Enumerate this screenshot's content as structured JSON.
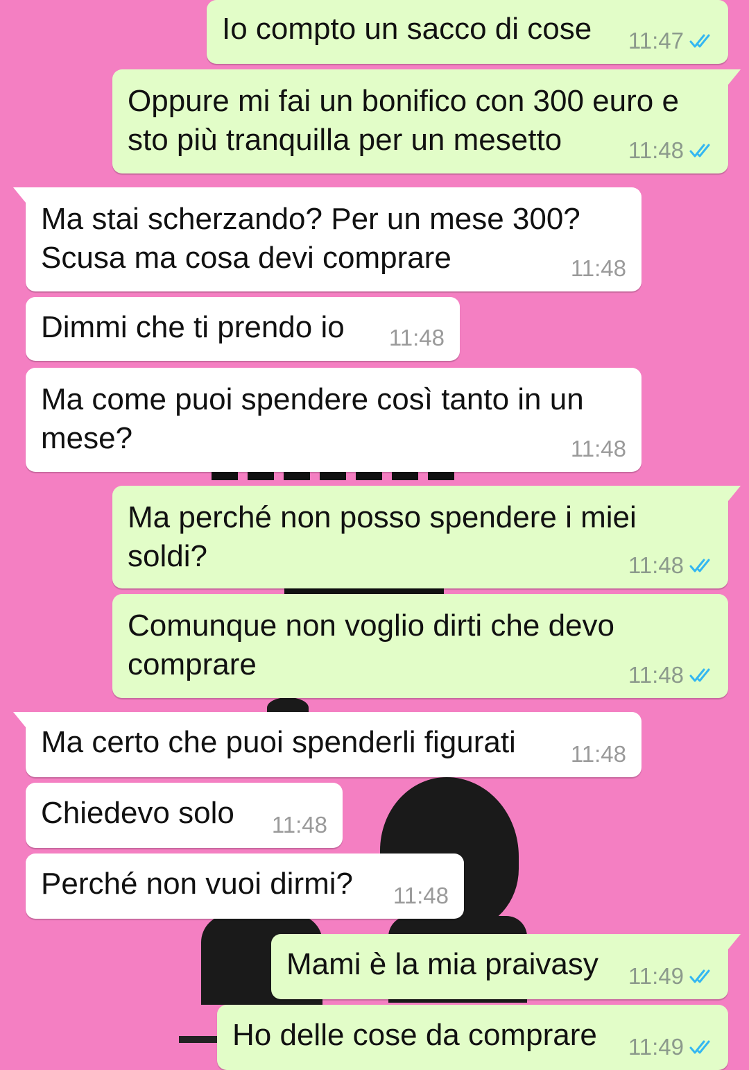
{
  "theme": {
    "wallpaper": "#f47fc2",
    "outgoing_bubble": "#e2fdc8",
    "incoming_bubble": "#ffffff",
    "read_ticks": "#34b7f1"
  },
  "messages": [
    {
      "direction": "out",
      "text": "Io compto un sacco di cose",
      "time": "11:47",
      "status_icon": "double-check-read-icon"
    },
    {
      "direction": "out",
      "text": "Oppure mi fai un bonifico con 300 euro e sto più tranquilla per un mesetto",
      "time": "11:48",
      "status_icon": "double-check-read-icon"
    },
    {
      "direction": "in",
      "text": "Ma stai scherzando? Per un mese 300? Scusa ma cosa devi comprare",
      "time": "11:48"
    },
    {
      "direction": "in",
      "text": "Dimmi che ti prendo io",
      "time": "11:48"
    },
    {
      "direction": "in",
      "text": "Ma come puoi spendere così tanto in un mese?",
      "time": "11:48"
    },
    {
      "direction": "out",
      "text": "Ma perché non posso spendere i miei soldi?",
      "time": "11:48",
      "status_icon": "double-check-read-icon"
    },
    {
      "direction": "out",
      "text": "Comunque non voglio dirti che devo comprare",
      "time": "11:48",
      "status_icon": "double-check-read-icon"
    },
    {
      "direction": "in",
      "text": "Ma certo che puoi spenderli figurati",
      "time": "11:48"
    },
    {
      "direction": "in",
      "text": "Chiedevo solo",
      "time": "11:48"
    },
    {
      "direction": "in",
      "text": "Perché non vuoi dirmi?",
      "time": "11:48"
    },
    {
      "direction": "out",
      "text": "Mami è la mia praivasy",
      "time": "11:49",
      "status_icon": "double-check-read-icon"
    },
    {
      "direction": "out",
      "text": "Ho delle cose da comprare",
      "time": "11:49",
      "status_icon": "double-check-read-icon"
    }
  ]
}
